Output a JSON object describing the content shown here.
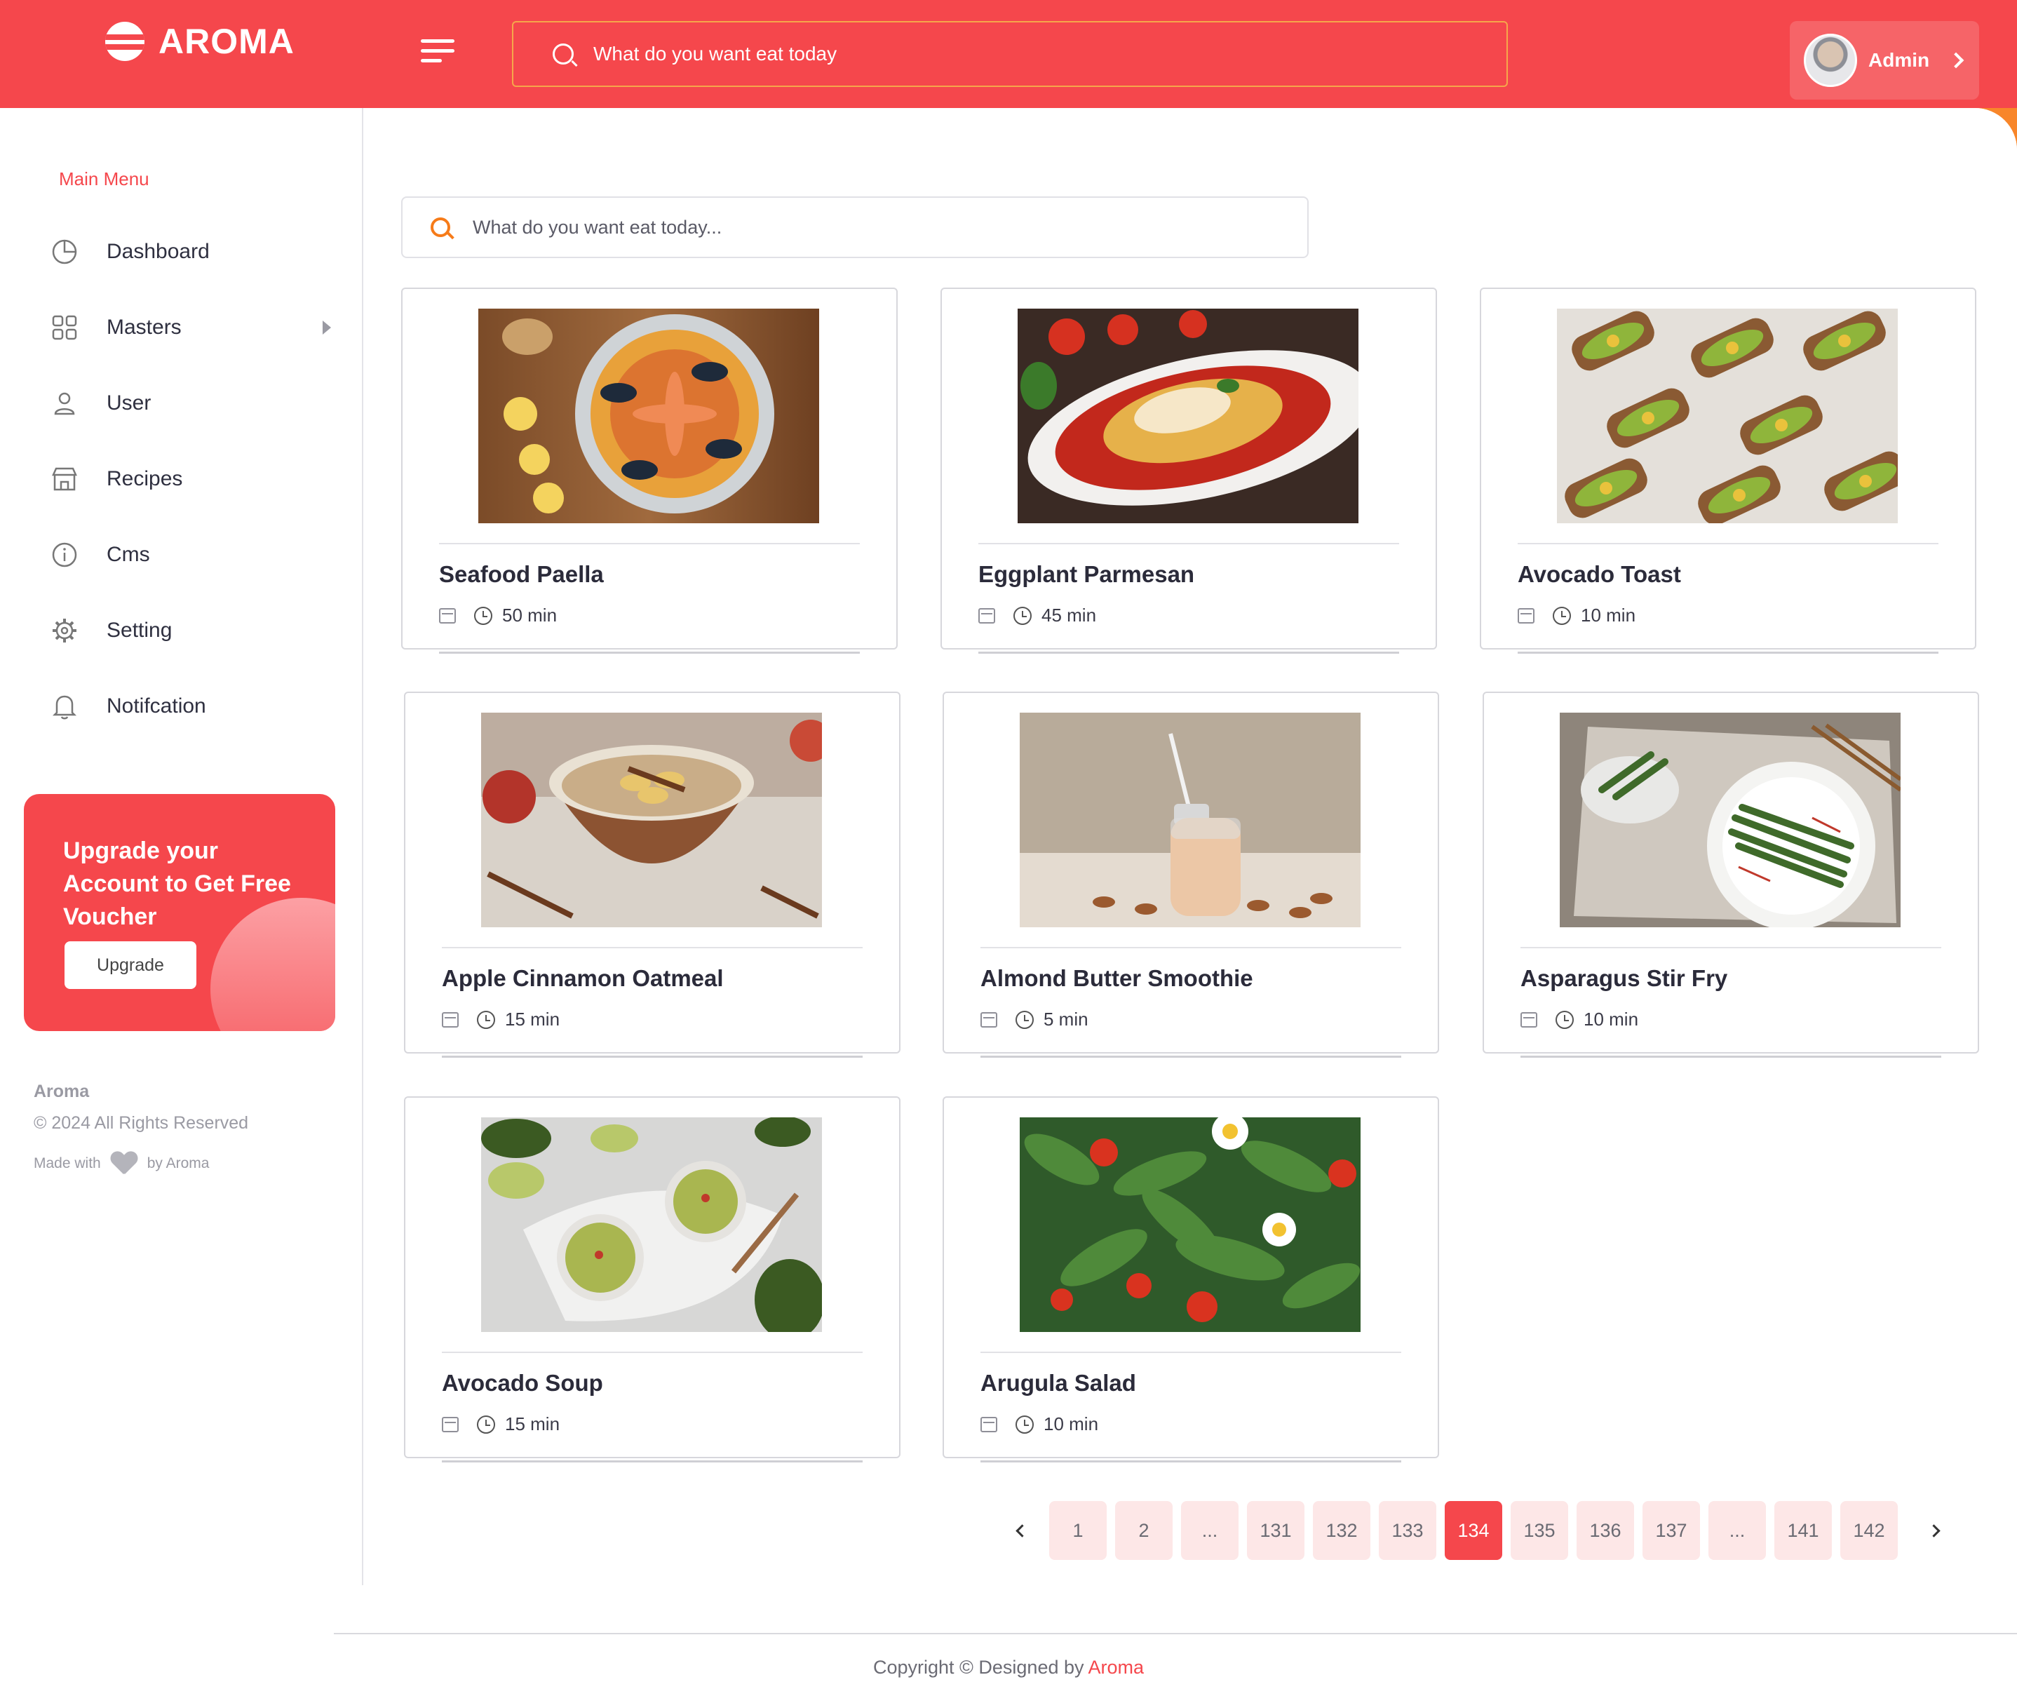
{
  "header": {
    "brand": "AROMA",
    "search_placeholder": "What do you want eat today",
    "user_name": "Admin"
  },
  "sidebar": {
    "menu_title": "Main Menu",
    "items": [
      {
        "label": "Dashboard",
        "icon": "pie-chart-icon"
      },
      {
        "label": "Masters",
        "icon": "grid-icon",
        "has_submenu": true
      },
      {
        "label": "User",
        "icon": "user-icon"
      },
      {
        "label": "Recipes",
        "icon": "store-icon"
      },
      {
        "label": "Cms",
        "icon": "info-icon"
      },
      {
        "label": "Setting",
        "icon": "gear-icon"
      },
      {
        "label": "Notifcation",
        "icon": "bell-icon"
      }
    ],
    "promo": {
      "text": "Upgrade your Account to Get Free Voucher",
      "button": "Upgrade"
    },
    "footer": {
      "brand": "Aroma",
      "copyright": "© 2024 All Rights Reserved",
      "made_with": "Made with",
      "by": "by Aroma"
    }
  },
  "main": {
    "search_placeholder": "What do you want eat today...",
    "recipes": [
      {
        "title": "Seafood Paella",
        "time": "50 min",
        "image": "seafood-paella"
      },
      {
        "title": "Eggplant Parmesan",
        "time": "45 min",
        "image": "eggplant-parmesan"
      },
      {
        "title": "Avocado Toast",
        "time": "10 min",
        "image": "avocado-toast"
      },
      {
        "title": "Apple Cinnamon Oatmeal",
        "time": "15 min",
        "image": "apple-cinnamon-oatmeal"
      },
      {
        "title": "Almond Butter Smoothie",
        "time": "5 min",
        "image": "almond-butter-smoothie"
      },
      {
        "title": "Asparagus Stir Fry",
        "time": "10 min",
        "image": "asparagus-stir-fry"
      },
      {
        "title": "Avocado Soup",
        "time": "15 min",
        "image": "avocado-soup"
      },
      {
        "title": "Arugula Salad",
        "time": "10 min",
        "image": "arugula-salad"
      }
    ],
    "pagination": {
      "pages": [
        "1",
        "2",
        "...",
        "131",
        "132",
        "133",
        "134",
        "135",
        "136",
        "137",
        "...",
        "141",
        "142"
      ],
      "current": "134"
    }
  },
  "page_footer": {
    "text": "Copyright © Designed by",
    "brand": "Aroma"
  },
  "colors": {
    "primary": "#f5474c",
    "accent": "#f67b19",
    "page_active_bg": "#f5474c",
    "page_bg": "#fde7e7"
  }
}
